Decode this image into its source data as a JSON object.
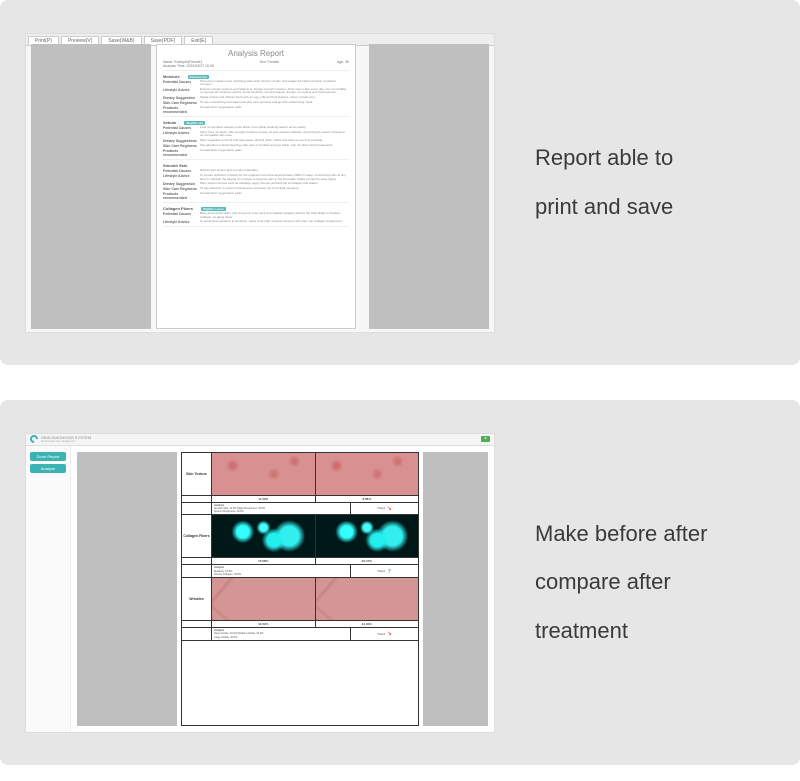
{
  "panel1": {
    "caption_line1": "Report able to",
    "caption_line2": "print and save",
    "tabs": [
      "Print(P)",
      "Preview(V)",
      "Save(W&B)",
      "Save(PDF)",
      "Exit(E)"
    ],
    "report": {
      "title": "Analysis Report",
      "header_name": "Name: Example(Female)",
      "header_sex": "Sex: Female",
      "header_age": "Age: 35",
      "header_time": "Analysis Time: 2020/03/27 10:05",
      "sections": [
        {
          "head": "Moisture",
          "badge": "Extreme dry",
          "rows": [
            {
              "label": "Potential Causes",
              "text": "Screening moisture loss, declining water-lock function of skin and weakened barrier function of stratum corneum."
            },
            {
              "label": "Lifestyle Advice",
              "text": "Ensure enough moisture and Vitamin A. Supply enough moisture, drink more water every day, use a humidifier to improve air moisture indoors. Avoid sunshine, hot and season change, air cooling and overexposure."
            },
            {
              "label": "Dietary Suggestion",
              "text": "Select protein and Vitamin food such as egg, milk and fruit (berries, carrot, tomato etc.)."
            },
            {
              "label": "Skin Care Regimens",
              "text": "To use moisturizing and water-lock skin care products and go with moisturizing mask."
            },
            {
              "label": "Products recommended",
              "text": "Consett Dew oxygenation pads"
            }
          ]
        },
        {
          "head": "Sebum",
          "badge": "Slightly oily",
          "rows": [
            {
              "label": "Potential Causes",
              "text": "Over oil secretion causes pores block. Incomplete cleaning lead to acnes easily."
            },
            {
              "label": "Lifestyle Advice",
              "text": "Spicy food not allow, offer enough moisture to keep oil-and-moisture balance. Avoid fog etc season change to do compatible skin care."
            },
            {
              "label": "Dietary Suggestions",
              "text": "More vegetable and fruit and less sweet, alcohol drink, coffee and oiled as much as possible."
            },
            {
              "label": "Skin Care Regimens",
              "text": "Pay attention to facial cleaning, take care of wrinkles and eye black. Can do vital nutrient treatments."
            },
            {
              "label": "Products recommended",
              "text": "Consett Dew oxygenation pads"
            }
          ]
        },
        {
          "head": "Smooth Skin",
          "badge": "",
          "rows": [
            {
              "label": "Potential Causes",
              "text": "Distinct skin texture and normal metabolism."
            },
            {
              "label": "Lifestyle Advice",
              "text": "To ensure sufficient moisture for the organism and drink approximately 2000 ml water; moisturizing skin at any time to maintain the degree of moisture to keep the skin in the best state; Relax yourself to keep happy."
            },
            {
              "label": "Dietary Suggestion",
              "text": "More Vitamin E food such as cabbage; apply diverse products full of collagen and elastin."
            },
            {
              "label": "Skin Care Regimens",
              "text": "To pay attention to current maintenance and keep out of sunlight exposure."
            },
            {
              "label": "Products recommended",
              "text": "Consett Dew oxygenation pads"
            }
          ]
        },
        {
          "head": "Collagen Fibers",
          "badge": "Slightly Loose",
          "rows": [
            {
              "label": "Potential Causes",
              "text": "Body and mental strain; plus long term busy work and radiation already destroy the cells ability to produce collagen, so aging faster."
            },
            {
              "label": "Lifestyle Advice",
              "text": "To avoid long exposure to sunshine, using more high moisture essence skin care; eat collagen supplement."
            }
          ]
        }
      ]
    }
  },
  "panel2": {
    "caption_line1": "Make before after",
    "caption_line2": "compare after",
    "caption_line3": "treatment",
    "app_title": "SKIN DIAGNOSIS SYSTEM",
    "app_subtitle": "Professional skin management",
    "close_label": "×",
    "sidebar": {
      "btn1": "Done Report",
      "btn2": "Analyze"
    },
    "table": {
      "rows": [
        {
          "label": "Skin Texture",
          "pct_left": "11.59%",
          "pct_right": "8.88%",
          "detail_title": "Analysis",
          "detail_lines": "Smooth Skin: 11.5%  Slight Roughness: 34.5%\nSevere Roughness: 29.2%",
          "trend_label": "Trend",
          "trend_dir": "down"
        },
        {
          "label": "Collagen Fibers",
          "pct_left": "15.68%",
          "pct_right": "36.47%",
          "detail_title": "Analysis",
          "detail_lines": "Elasticity: 15.5%\nIntense Collagen: 45.5%",
          "trend_label": "Trend",
          "trend_dir": "up"
        },
        {
          "label": "Wrinkles",
          "pct_left": "31.52%",
          "pct_right": "44.32%",
          "detail_title": "Analysis",
          "detail_lines": "Deep wrinkle: 34.0%  Medium wrinkle: 42.0%\nLarge wrinkle: 36.0%",
          "trend_label": "Trend",
          "trend_dir": "down"
        }
      ]
    }
  }
}
